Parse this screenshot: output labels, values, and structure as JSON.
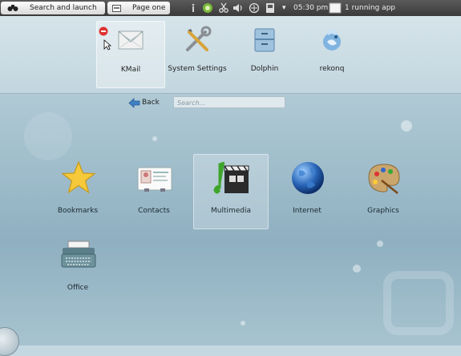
{
  "panel": {
    "launch_label": "Search and launch",
    "page_label": "Page one",
    "clock": "05:30 pm",
    "running_apps": "1 running app"
  },
  "favorites": [
    {
      "label": "KMail",
      "icon": "mail-icon"
    },
    {
      "label": "System Settings",
      "icon": "settings-tools-icon"
    },
    {
      "label": "Dolphin",
      "icon": "file-manager-icon"
    },
    {
      "label": "rekonq",
      "icon": "web-browser-icon"
    }
  ],
  "nav": {
    "back_label": "Back",
    "search_placeholder": "Search..."
  },
  "categories": [
    {
      "label": "Bookmarks",
      "icon": "star-icon"
    },
    {
      "label": "Contacts",
      "icon": "contact-card-icon"
    },
    {
      "label": "Multimedia",
      "icon": "multimedia-icon"
    },
    {
      "label": "Internet",
      "icon": "globe-icon"
    },
    {
      "label": "Graphics",
      "icon": "palette-icon"
    },
    {
      "label": "Office",
      "icon": "typewriter-icon"
    }
  ]
}
